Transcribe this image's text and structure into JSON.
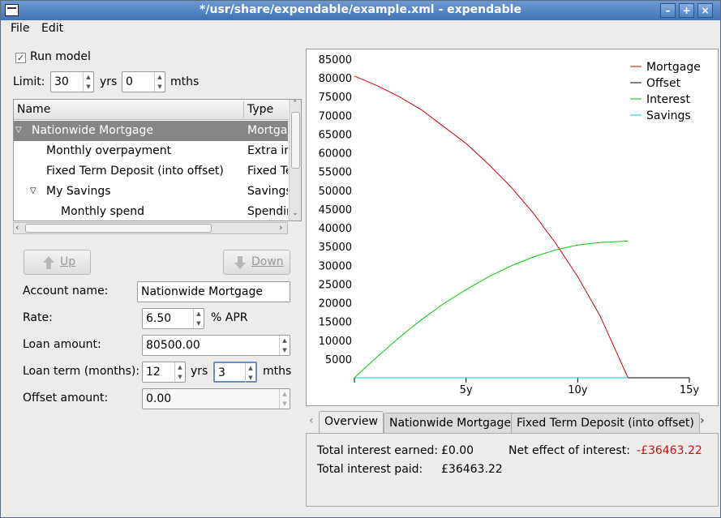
{
  "window": {
    "title": "*/usr/share/expendable/example.xml - expendable"
  },
  "menubar": {
    "file": "File",
    "edit": "Edit"
  },
  "controls": {
    "run_model_label": "Run model",
    "limit_label": "Limit:",
    "limit_years": "30",
    "yrs_label": "yrs",
    "limit_months": "0",
    "mths_label": "mths"
  },
  "tree": {
    "col_name": "Name",
    "col_type": "Type",
    "rows": [
      {
        "name": "Nationwide Mortgage",
        "type": "Mortgage",
        "expander": "open",
        "selected": true
      },
      {
        "name": "Monthly overpayment",
        "type": "Extra income"
      },
      {
        "name": "Fixed Term Deposit (into offset)",
        "type": "Fixed Term"
      },
      {
        "name": "My Savings",
        "type": "Savings",
        "expander": "open"
      },
      {
        "name": "Monthly spend",
        "type": "Spending"
      }
    ]
  },
  "buttons": {
    "up": "Up",
    "down": "Down"
  },
  "form": {
    "account_name_label": "Account name:",
    "account_name": "Nationwide Mortgage",
    "rate_label": "Rate:",
    "rate": "6.50",
    "rate_unit": "% APR",
    "loan_amount_label": "Loan amount:",
    "loan_amount": "80500.00",
    "loan_term_label": "Loan term (months):",
    "loan_term_years": "12",
    "yrs_label": "yrs",
    "loan_term_months": "3",
    "mths_label": "mths",
    "offset_amount_label": "Offset amount:",
    "offset_amount": "0.00"
  },
  "chart_data": {
    "type": "line",
    "xlabel": "",
    "ylabel": "",
    "xlim": [
      0,
      15
    ],
    "ylim": [
      0,
      85000
    ],
    "x_ticks": [
      {
        "value": 5,
        "label": "5y"
      },
      {
        "value": 10,
        "label": "10y"
      },
      {
        "value": 15,
        "label": "15y"
      }
    ],
    "y_ticks": [
      5000,
      10000,
      15000,
      20000,
      25000,
      30000,
      35000,
      40000,
      45000,
      50000,
      55000,
      60000,
      65000,
      70000,
      75000,
      80000,
      85000
    ],
    "legend_position": "top-right",
    "grid": false,
    "series": [
      {
        "name": "Mortgage",
        "color": "#cc0000",
        "x": [
          0,
          1,
          2,
          3,
          4,
          5,
          6,
          7,
          8,
          9,
          10,
          11,
          12.25,
          15
        ],
        "y": [
          80500,
          78000,
          75000,
          71500,
          67000,
          62500,
          57000,
          51000,
          44000,
          36000,
          27000,
          16500,
          0,
          0
        ]
      },
      {
        "name": "Offset",
        "color": "#000000",
        "x": [
          0,
          15
        ],
        "y": [
          0,
          0
        ]
      },
      {
        "name": "Interest",
        "color": "#00cc00",
        "x": [
          0,
          1,
          2,
          3,
          4,
          5,
          6,
          7,
          8,
          9,
          10,
          11,
          12.25
        ],
        "y": [
          0,
          5500,
          10700,
          15500,
          19800,
          23500,
          26900,
          29800,
          32200,
          34100,
          35400,
          36100,
          36463
        ]
      },
      {
        "name": "Savings",
        "color": "#00cccc",
        "x": [
          0,
          12.25
        ],
        "y": [
          0,
          0
        ]
      }
    ]
  },
  "tabs": {
    "items": [
      "Overview",
      "Nationwide Mortgage",
      "Fixed Term Deposit (into offset)"
    ],
    "active": 0
  },
  "overview": {
    "total_interest_earned_label": "Total interest earned:",
    "total_interest_earned": "£0.00",
    "total_interest_paid_label": "Total interest paid:",
    "total_interest_paid": "£36463.22",
    "net_effect_label": "Net effect of interest:",
    "net_effect": "-£36463.22",
    "net_effect_color": "#d01010"
  }
}
